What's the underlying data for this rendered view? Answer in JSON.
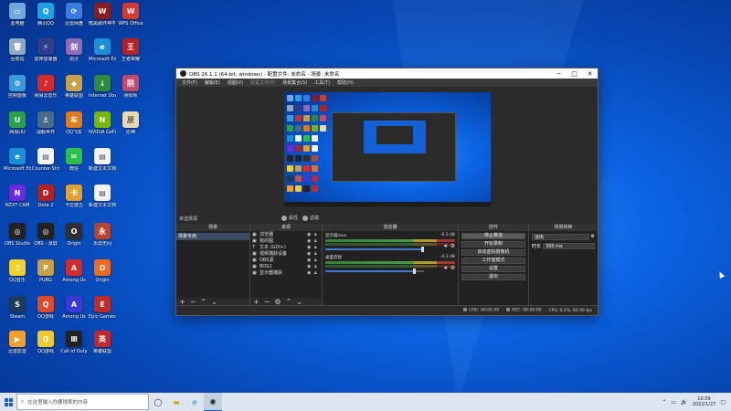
{
  "colors": {
    "desktop_bg": "#0b63e3",
    "obs_bg": "#2b2b2b",
    "accent": "#3e7bd6",
    "taskbar": "#dde6f0"
  },
  "desktop_icons": [
    {
      "label": "此电脑",
      "color": "#6fa8dc",
      "glyph": "▭",
      "col": 0,
      "row": 0
    },
    {
      "label": "腾讯QQ",
      "color": "#1aa1e6",
      "glyph": "Q",
      "col": 1,
      "row": 0
    },
    {
      "label": "迅雷网盘",
      "color": "#3a7be0",
      "glyph": "⟳",
      "col": 2,
      "row": 0
    },
    {
      "label": "暗黑破坏神不朽",
      "color": "#8a1c1c",
      "glyph": "W",
      "col": 3,
      "row": 0
    },
    {
      "label": "WPS Office",
      "color": "#d63b2f",
      "glyph": "W",
      "col": 4,
      "row": 0
    },
    {
      "label": "回收站",
      "color": "#8fa9c5",
      "glyph": "🗑",
      "col": 0,
      "row": 1
    },
    {
      "label": "雷神加速器",
      "color": "#2c3e8c",
      "glyph": "⚡",
      "col": 1,
      "row": 1
    },
    {
      "label": "剑灵",
      "color": "#8e6bb8",
      "glyph": "剑",
      "col": 2,
      "row": 1
    },
    {
      "label": "Microsoft Edge",
      "color": "#1a8fd8",
      "glyph": "e",
      "col": 3,
      "row": 1
    },
    {
      "label": "王者荣耀",
      "color": "#b22222",
      "glyph": "王",
      "col": 4,
      "row": 1
    },
    {
      "label": "控制面板",
      "color": "#3a9bd8",
      "glyph": "⚙",
      "col": 0,
      "row": 2
    },
    {
      "label": "网易云音乐",
      "color": "#d42a2a",
      "glyph": "♪",
      "col": 1,
      "row": 2
    },
    {
      "label": "英雄联盟",
      "color": "#c8a04a",
      "glyph": "◆",
      "col": 2,
      "row": 2
    },
    {
      "label": "Internet Download Manager",
      "color": "#2f8a3b",
      "glyph": "↓",
      "col": 3,
      "row": 2
    },
    {
      "label": "阴阳师",
      "color": "#c24b6b",
      "glyph": "阴",
      "col": 4,
      "row": 2
    },
    {
      "label": "网易UU",
      "color": "#2aa04a",
      "glyph": "U",
      "col": 0,
      "row": 3
    },
    {
      "label": "战舰世界",
      "color": "#4a6a8a",
      "glyph": "⚓",
      "col": 1,
      "row": 3
    },
    {
      "label": "QQ飞车",
      "color": "#e07b1a",
      "glyph": "车",
      "col": 2,
      "row": 3
    },
    {
      "label": "NVIDIA GeForce",
      "color": "#76b900",
      "glyph": "N",
      "col": 3,
      "row": 3
    },
    {
      "label": "原神",
      "color": "#e8d9b0",
      "glyph": "原",
      "col": 4,
      "row": 3
    },
    {
      "label": "Microsoft Edge",
      "color": "#1a8fd8",
      "glyph": "e",
      "col": 0,
      "row": 4
    },
    {
      "label": "Counter-Strike",
      "color": "#f2f2f2",
      "glyph": "▤",
      "col": 1,
      "row": 4
    },
    {
      "label": "微信",
      "color": "#2ac04a",
      "glyph": "✉",
      "col": 2,
      "row": 4
    },
    {
      "label": "新建文本文档",
      "color": "#f2f2f2",
      "glyph": "▤",
      "col": 3,
      "row": 4
    },
    {
      "label": "NZXT CAM",
      "color": "#6a2ae0",
      "glyph": "N",
      "col": 0,
      "row": 5
    },
    {
      "label": "Dota 2",
      "color": "#b22222",
      "glyph": "D",
      "col": 1,
      "row": 5
    },
    {
      "label": "卡拉彼丘",
      "color": "#e0a030",
      "glyph": "卡",
      "col": 2,
      "row": 5
    },
    {
      "label": "新建文本文档",
      "color": "#f2f2f2",
      "glyph": "▤",
      "col": 3,
      "row": 5
    },
    {
      "label": "OBS Studio",
      "color": "#222222",
      "glyph": "◎",
      "col": 0,
      "row": 6
    },
    {
      "label": "OBS - 录屏",
      "color": "#222222",
      "glyph": "◎",
      "col": 1,
      "row": 6
    },
    {
      "label": "Origin",
      "color": "#2f2f2f",
      "glyph": "O",
      "col": 2,
      "row": 6
    },
    {
      "label": "永劫无间",
      "color": "#b8452a",
      "glyph": "永",
      "col": 3,
      "row": 6
    },
    {
      "label": "QQ音乐",
      "color": "#f2d12a",
      "glyph": "♫",
      "col": 0,
      "row": 7
    },
    {
      "label": "PUBG",
      "color": "#c8a040",
      "glyph": "P",
      "col": 1,
      "row": 7
    },
    {
      "label": "Among Us",
      "color": "#d42a2a",
      "glyph": "A",
      "col": 2,
      "row": 7
    },
    {
      "label": "Origin",
      "color": "#f26b1d",
      "glyph": "O",
      "col": 3,
      "row": 7
    },
    {
      "label": "Steam",
      "color": "#1b3a5c",
      "glyph": "S",
      "col": 0,
      "row": 8
    },
    {
      "label": "QQ游戏",
      "color": "#e04a2a",
      "glyph": "Q",
      "col": 1,
      "row": 8
    },
    {
      "label": "Among Us",
      "color": "#3a3ad8",
      "glyph": "A",
      "col": 2,
      "row": 8
    },
    {
      "label": "Epic Games Launcher",
      "color": "#c22a2a",
      "glyph": "E",
      "col": 3,
      "row": 8
    },
    {
      "label": "迅雷影音",
      "color": "#f2a02a",
      "glyph": "▶",
      "col": 0,
      "row": 9
    },
    {
      "label": "QQ游戏",
      "color": "#f2c82a",
      "glyph": "Q",
      "col": 1,
      "row": 9
    },
    {
      "label": "Call of Duty",
      "color": "#222222",
      "glyph": "Ⅲ",
      "col": 2,
      "row": 9
    },
    {
      "label": "英雄联盟",
      "color": "#c22a2a",
      "glyph": "英",
      "col": 3,
      "row": 9
    }
  ],
  "obs": {
    "title": "OBS 26.1.1 (64-bit, windows) - 配置文件: 未命名 - 场景: 未命名",
    "menu": [
      {
        "label": "文件(F)",
        "dim": false
      },
      {
        "label": "编辑(E)",
        "dim": false
      },
      {
        "label": "视图(V)",
        "dim": false
      },
      {
        "label": "配置文件(P)",
        "dim": true
      },
      {
        "label": "场景集合(S)",
        "dim": false
      },
      {
        "label": "工具(T)",
        "dim": false
      },
      {
        "label": "帮助(H)",
        "dim": false
      }
    ],
    "source_bar_label": "未选择源",
    "properties_label": "属性",
    "filters_label": "滤镜",
    "docks": {
      "scenes": {
        "header": "场景",
        "items": [
          "场景专用"
        ]
      },
      "sources": {
        "header": "来源",
        "items": [
          {
            "icon": "▣",
            "name": "浏览器"
          },
          {
            "icon": "▣",
            "name": "我的图"
          },
          {
            "icon": "T",
            "name": "文本 (GDI+)"
          },
          {
            "icon": "▣",
            "name": "视频捕获设备"
          },
          {
            "icon": "▣",
            "name": "OBS源"
          },
          {
            "icon": "▣",
            "name": "BOS2"
          },
          {
            "icon": "▣",
            "name": "显示器捕获"
          }
        ]
      },
      "mixer": {
        "header": "混音器",
        "tracks": [
          {
            "name": "显示器/aux",
            "db": "-0.3 dB",
            "level": 1.0
          },
          {
            "name": "桌面音频",
            "db": "-4.3 dB",
            "level": 0.92
          }
        ]
      },
      "controls": {
        "header": "控件",
        "buttons": [
          {
            "label": "停止推流",
            "active": true
          },
          {
            "label": "开始录制",
            "active": false
          },
          {
            "label": "启动虚拟摄像机",
            "active": false
          },
          {
            "label": "工作室模式",
            "active": false
          },
          {
            "label": "设置",
            "active": false
          },
          {
            "label": "退出",
            "active": false
          }
        ]
      },
      "transitions": {
        "header": "场景转换",
        "selected": "淡出",
        "duration_label": "时长",
        "duration_value": "300 ms"
      }
    },
    "status": {
      "live_label": "LIVE:",
      "live_time": "00:00:00",
      "rec_label": "REC:",
      "rec_time": "00:00:00",
      "cpu": "CPU: 0.4%, 60.00 fps"
    }
  },
  "taskbar": {
    "search_placeholder": "在这里输入你要搜索的内容",
    "time": "10:09",
    "date": "2022/1/27"
  }
}
